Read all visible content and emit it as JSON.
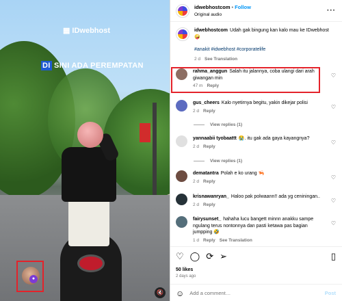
{
  "video": {
    "brand": "IDwebhost",
    "caption_highlight": "DI",
    "caption_rest": " SINI ADA PEREMPATAN"
  },
  "header": {
    "username": "idwebhostcom",
    "separator": "•",
    "follow": "Follow",
    "audio": "Original audio"
  },
  "post": {
    "username": "idwebhostcom",
    "text": "Udah gak bingung kan kalo mau ke IDwebhost",
    "emoji": "🤪",
    "tags": "#anakit #idwebhost #corporatelife",
    "time": "2 d",
    "translation": "See Translation"
  },
  "comments": [
    {
      "user": "rahma_anggun",
      "text": "Salah itu jalannya, coba ulangi dari arah giwangan min",
      "time": "47 m",
      "reply": "Reply",
      "color": "#8d6e63"
    },
    {
      "user": "gus_cheers",
      "text": "Kalo nyetirnya begitu, yakin dikejar polisi",
      "time": "2 d",
      "reply": "Reply",
      "views": "View replies (1)",
      "color": "#5c6bc0"
    },
    {
      "user": "yannaabii tyobaattt",
      "text": "😭. itu gak ada gaya kayangnya?",
      "time": "2 d",
      "reply": "Reply",
      "views": "View replies (1)",
      "color": "#e0e0e0"
    },
    {
      "user": "dematantra",
      "text": "Polah e ko urang 🦐",
      "time": "2 d",
      "reply": "Reply",
      "color": "#6d4c41"
    },
    {
      "user": "krisnawanryan_",
      "text": "Haloo pak polwaann!! ada yg ceniningan..",
      "time": "2 d",
      "reply": "Reply",
      "color": "#263238"
    },
    {
      "user": "fairysunset_",
      "text": "hahaha lucu bangett minnn anakku sampe ngulang terus nontonnya dan pasti ketawa pas bagian jumpping 🤣",
      "time": "1 d",
      "reply": "Reply",
      "translation": "See Translation",
      "color": "#546e7a"
    }
  ],
  "actions": {
    "likes": "50 likes",
    "ago": "2 days ago",
    "add_comment": "Add a comment…",
    "post_button": "Post"
  }
}
